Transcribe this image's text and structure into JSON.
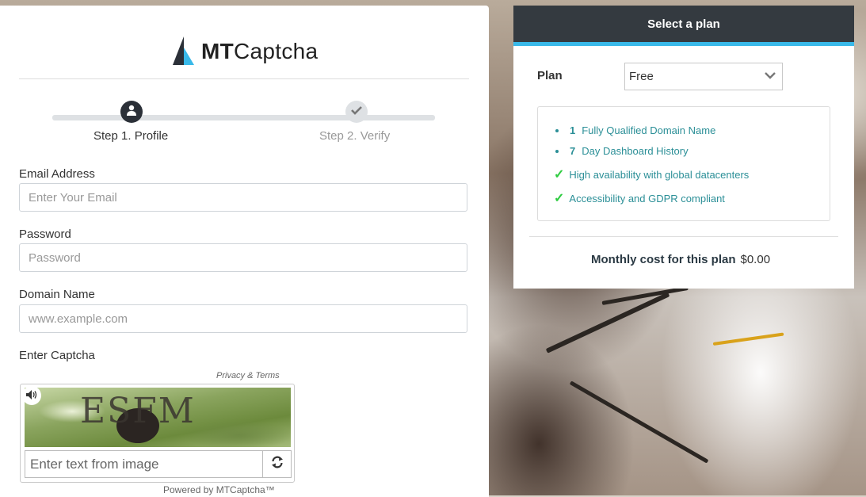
{
  "brand": {
    "name_bold": "MT",
    "name_light": "Captcha"
  },
  "stepper": {
    "steps": [
      {
        "label": "Step 1. Profile",
        "active": true
      },
      {
        "label": "Step 2. Verify",
        "active": false
      }
    ]
  },
  "form": {
    "email": {
      "label": "Email Address",
      "placeholder": "Enter Your Email",
      "value": ""
    },
    "password": {
      "label": "Password",
      "placeholder": "Password",
      "value": ""
    },
    "domain": {
      "label": "Domain Name",
      "placeholder": "www.example.com",
      "value": ""
    },
    "captcha_label": "Enter Captcha"
  },
  "captcha": {
    "privacy": "Privacy & Terms",
    "image_text": "ESFM",
    "input_placeholder": "Enter text from image",
    "powered_by": "Powered by MTCaptcha™"
  },
  "plan_panel": {
    "title": "Select a plan",
    "plan_label": "Plan",
    "selected": "Free",
    "features": [
      {
        "num": "1",
        "text": "Fully Qualified Domain Name",
        "kind": "bullet"
      },
      {
        "num": "7",
        "text": "Day Dashboard History",
        "kind": "bullet"
      },
      {
        "num": "",
        "text": "High availability with global datacenters",
        "kind": "check"
      },
      {
        "num": "",
        "text": "Accessibility and GDPR compliant",
        "kind": "check"
      }
    ],
    "cost_label": "Monthly cost for this plan",
    "cost_value": "$0.00"
  },
  "colors": {
    "header_dark": "#343a40",
    "header_accent": "#39b9e9",
    "feature_teal": "#2b8f97",
    "check_green": "#2ecc40",
    "step_active": "#2b3038",
    "step_inactive": "#dee1e4"
  },
  "icons": {
    "user_icon": "user-icon",
    "check_icon": "check-icon",
    "audio_icon": "speaker-icon",
    "refresh_icon": "refresh-icon",
    "chevron": "chevron-down-icon"
  }
}
